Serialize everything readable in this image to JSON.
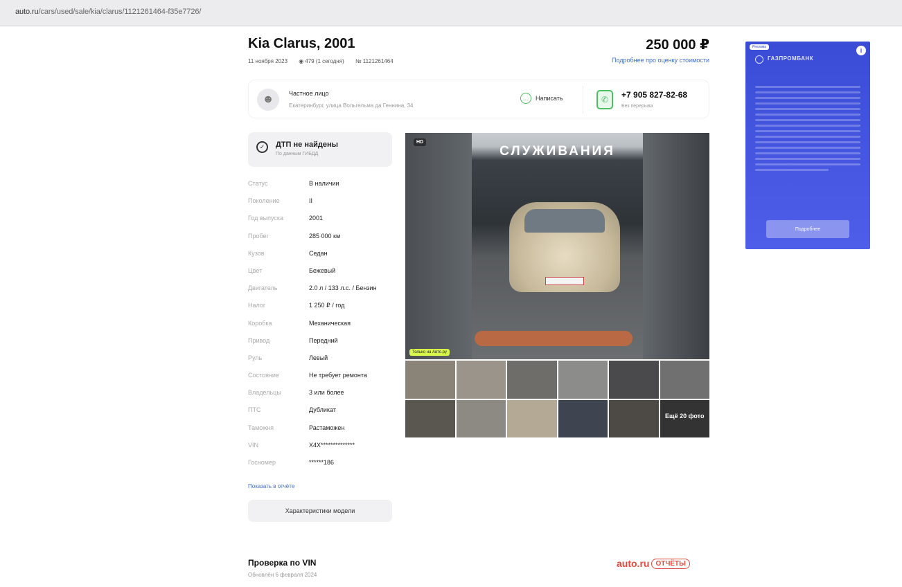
{
  "browser": {
    "url_domain": "auto.ru",
    "url_path": "/cars/used/sale/kia/clarus/1121261464-f35e7726/"
  },
  "listing": {
    "title": "Kia Clarus, 2001",
    "price": "250 000 ₽",
    "date": "11 ноября 2023",
    "views": "479 (1 сегодня)",
    "number": "№ 1121261464",
    "price_link": "Подробнее про оценку стоимости"
  },
  "seller": {
    "type": "Частное лицо",
    "address": "Екатеринбург, улица Вольгельма да Геннина, 34",
    "write_label": "Написать",
    "phone": "+7 905 827-82-68",
    "phone_note": "Без перерыва"
  },
  "dtp": {
    "title": "ДТП не найдены",
    "subtitle": "По данным ГИБДД"
  },
  "specs": [
    {
      "k": "Статус",
      "v": "В наличии"
    },
    {
      "k": "Поколение",
      "v": "II"
    },
    {
      "k": "Год выпуска",
      "v": "2001"
    },
    {
      "k": "Пробег",
      "v": "285 000 км"
    },
    {
      "k": "Кузов",
      "v": "Седан"
    },
    {
      "k": "Цвет",
      "v": "Бежевый"
    },
    {
      "k": "Двигатель",
      "v": "2.0 л / 133 л.с. / Бензин"
    },
    {
      "k": "Налог",
      "v": "1 250 ₽ / год"
    },
    {
      "k": "Коробка",
      "v": "Механическая"
    },
    {
      "k": "Привод",
      "v": "Передний"
    },
    {
      "k": "Руль",
      "v": "Левый"
    },
    {
      "k": "Состояние",
      "v": "Не требует ремонта"
    },
    {
      "k": "Владельцы",
      "v": "3 или более"
    },
    {
      "k": "ПТС",
      "v": "Дубликат"
    },
    {
      "k": "Таможня",
      "v": "Растаможен"
    },
    {
      "k": "VIN",
      "v": "X4X**************"
    },
    {
      "k": "Госномер",
      "v": "******186"
    }
  ],
  "show_report": "Показать в отчёте",
  "model_specs_button": "Характеристики модели",
  "gallery": {
    "hd_badge": "HD",
    "photo_sign": "СЛУЖИВАНИЯ",
    "photo_tag": "Только на Авто.ру",
    "more_photos": "Ещё 20 фото",
    "colors": {
      "tag": "#d8f94a",
      "bumper": "#b96a45"
    }
  },
  "vin": {
    "title": "Проверка по VIN",
    "subtitle": "Обновлён 6 февраля 2024",
    "logo_text": "auto.ru",
    "logo_badge": "ОТЧЁТЫ",
    "logo_color": "#e24a3c"
  },
  "ad": {
    "label": "Реклама",
    "brand": "ГАЗПРОМБАНК",
    "button": "Подробнее",
    "color": "#3a4cd6"
  },
  "icons": [
    "eye-icon",
    "avatar-icon",
    "chat-icon",
    "phone-icon",
    "check-icon",
    "info-icon"
  ]
}
